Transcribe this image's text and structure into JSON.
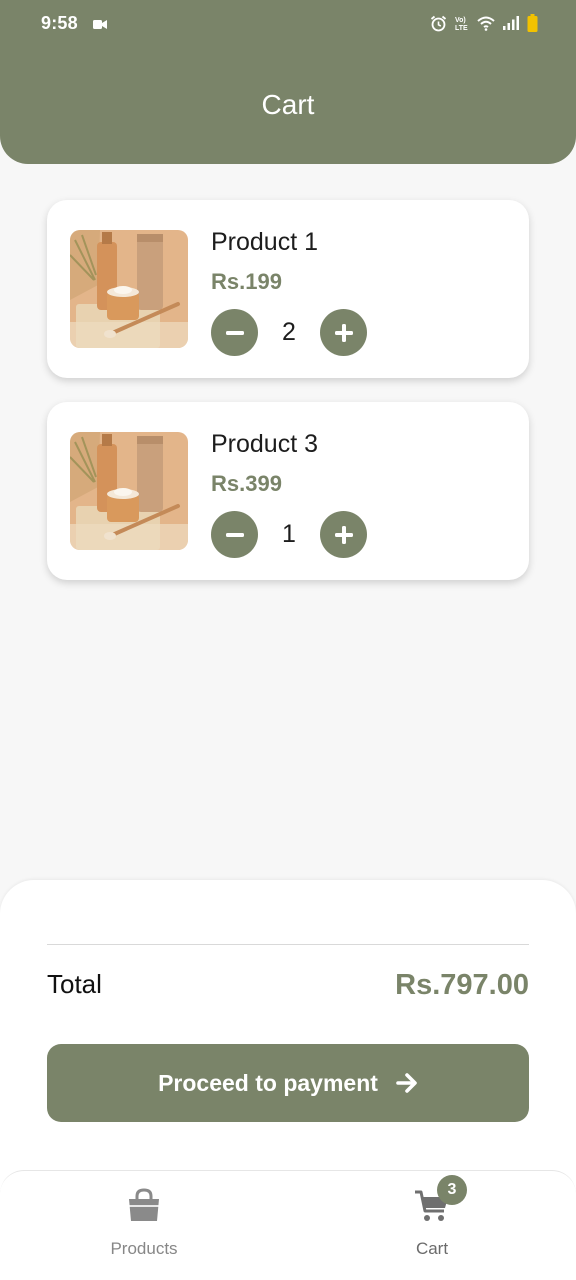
{
  "status_bar": {
    "time": "9:58"
  },
  "header": {
    "title": "Cart"
  },
  "cart_items": [
    {
      "name": "Product 1",
      "price": "Rs.199",
      "quantity": "2"
    },
    {
      "name": "Product 3",
      "price": "Rs.399",
      "quantity": "1"
    }
  ],
  "summary": {
    "total_label": "Total",
    "total_value": "Rs.797.00",
    "pay_button_label": "Proceed to payment"
  },
  "bottom_nav": {
    "items": [
      {
        "label": "Products",
        "icon": "shopping-bag-icon"
      },
      {
        "label": "Cart",
        "icon": "cart-icon",
        "badge": "3"
      }
    ]
  },
  "colors": {
    "accent": "#7a8469",
    "background": "#f7f7f7",
    "card": "#ffffff"
  }
}
